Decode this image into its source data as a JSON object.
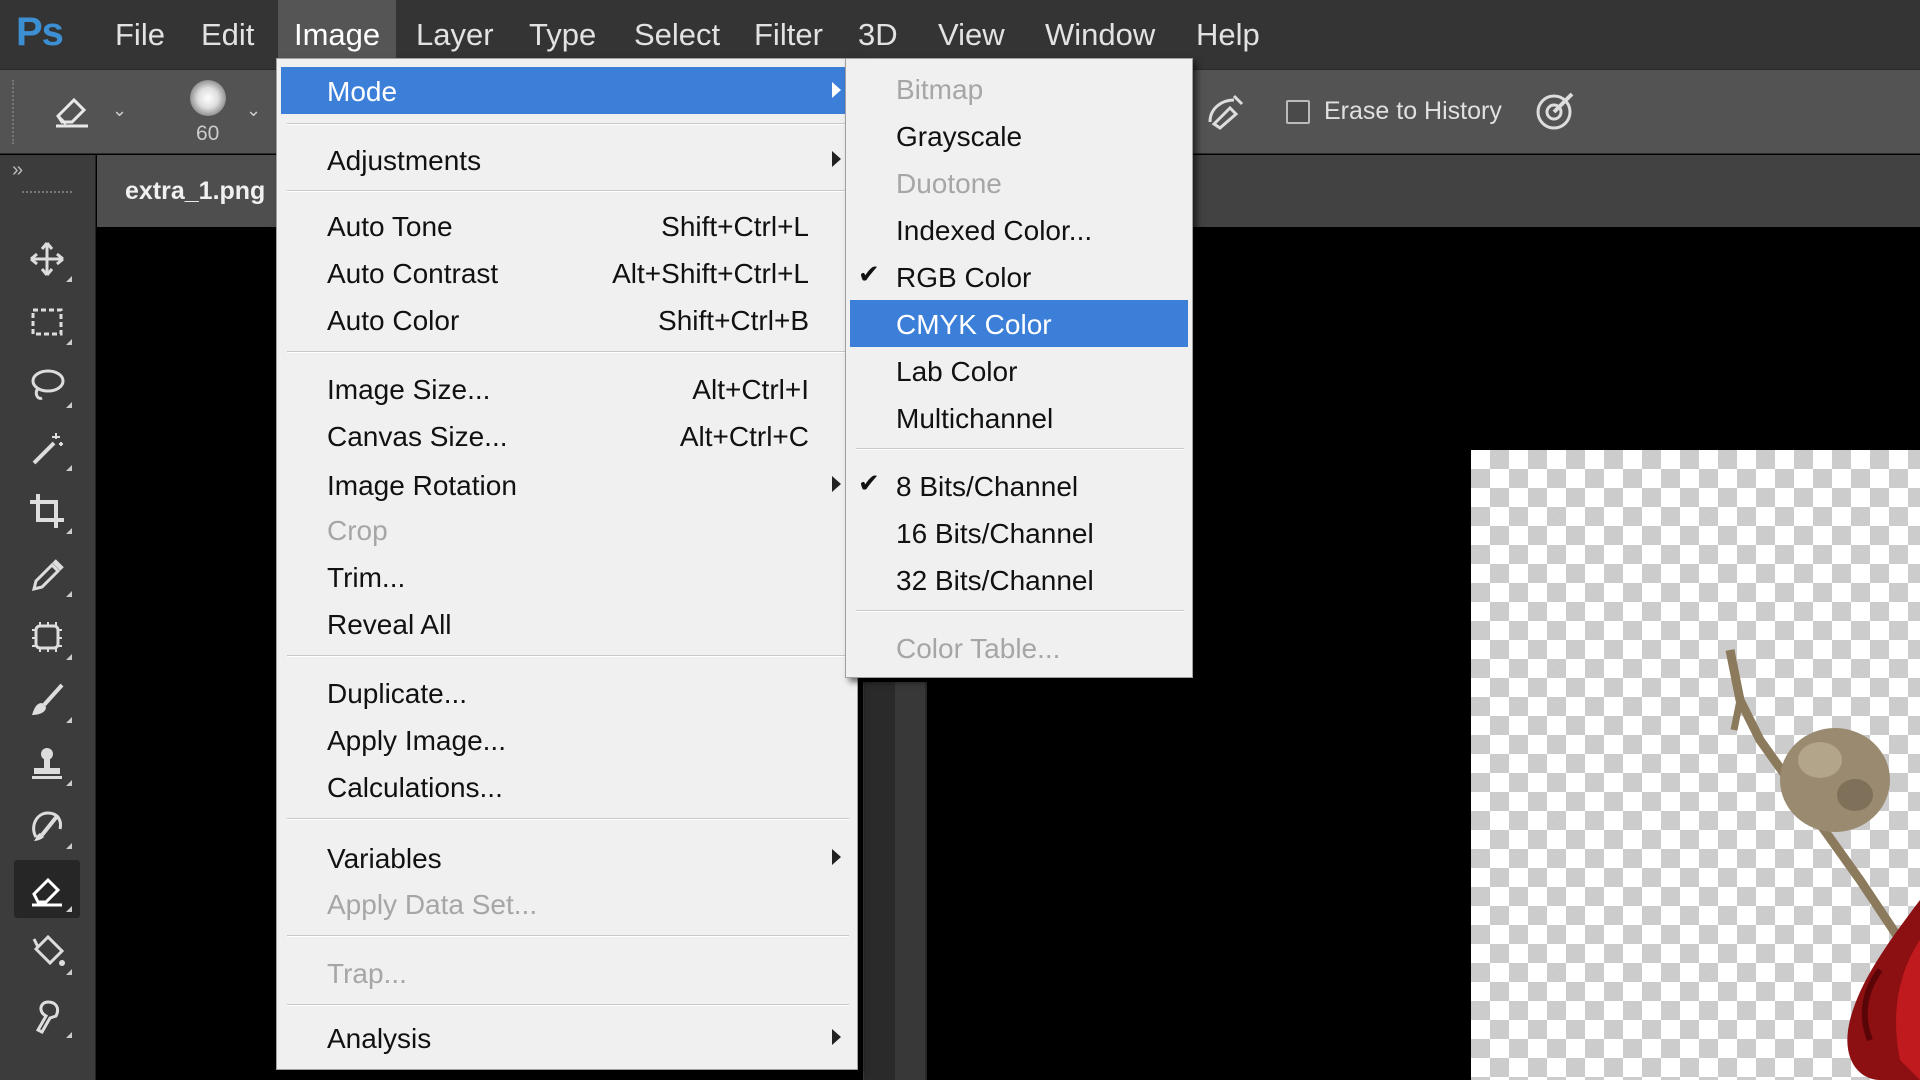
{
  "app": {
    "logo": "Ps"
  },
  "menubar": {
    "items": [
      {
        "label": "File"
      },
      {
        "label": "Edit"
      },
      {
        "label": "Image"
      },
      {
        "label": "Layer"
      },
      {
        "label": "Type"
      },
      {
        "label": "Select"
      },
      {
        "label": "Filter"
      },
      {
        "label": "3D"
      },
      {
        "label": "View"
      },
      {
        "label": "Window"
      },
      {
        "label": "Help"
      }
    ],
    "open_item": "Image"
  },
  "options_bar": {
    "tool_icon": "eraser-icon",
    "brush_size": "60",
    "erase_to_history_label": "Erase to History",
    "erase_to_history_checked": false,
    "airbrush_icon": "airbrush-icon",
    "pressure_icon": "pressure-opacity-icon"
  },
  "toolbox": {
    "collapse": "»",
    "tools": [
      {
        "icon": "move-icon"
      },
      {
        "icon": "rectangular-marquee-icon"
      },
      {
        "icon": "lasso-icon"
      },
      {
        "icon": "magic-wand-icon"
      },
      {
        "icon": "crop-icon"
      },
      {
        "icon": "eyedropper-icon"
      },
      {
        "icon": "patch-tool-icon"
      },
      {
        "icon": "brush-icon"
      },
      {
        "icon": "clone-stamp-icon"
      },
      {
        "icon": "history-brush-icon"
      },
      {
        "icon": "eraser-icon",
        "active": true
      },
      {
        "icon": "paint-bucket-icon"
      },
      {
        "icon": "smudge-icon"
      }
    ]
  },
  "document": {
    "tab_label": "extra_1.png"
  },
  "image_menu": {
    "items": {
      "mode": {
        "label": "Mode",
        "submenu": true,
        "highlighted": true
      },
      "adjustments": {
        "label": "Adjustments",
        "submenu": true
      },
      "auto_tone": {
        "label": "Auto Tone",
        "shortcut": "Shift+Ctrl+L"
      },
      "auto_contrast": {
        "label": "Auto Contrast",
        "shortcut": "Alt+Shift+Ctrl+L"
      },
      "auto_color": {
        "label": "Auto Color",
        "shortcut": "Shift+Ctrl+B"
      },
      "image_size": {
        "label": "Image Size...",
        "shortcut": "Alt+Ctrl+I"
      },
      "canvas_size": {
        "label": "Canvas Size...",
        "shortcut": "Alt+Ctrl+C"
      },
      "image_rotation": {
        "label": "Image Rotation",
        "submenu": true
      },
      "crop": {
        "label": "Crop",
        "disabled": true
      },
      "trim": {
        "label": "Trim..."
      },
      "reveal_all": {
        "label": "Reveal All"
      },
      "duplicate": {
        "label": "Duplicate..."
      },
      "apply_image": {
        "label": "Apply Image..."
      },
      "calculations": {
        "label": "Calculations..."
      },
      "variables": {
        "label": "Variables",
        "submenu": true
      },
      "apply_data_set": {
        "label": "Apply Data Set...",
        "disabled": true
      },
      "trap": {
        "label": "Trap...",
        "disabled": true
      },
      "analysis": {
        "label": "Analysis",
        "submenu": true
      }
    }
  },
  "mode_submenu": {
    "items": {
      "bitmap": {
        "label": "Bitmap",
        "disabled": true
      },
      "grayscale": {
        "label": "Grayscale"
      },
      "duotone": {
        "label": "Duotone",
        "disabled": true
      },
      "indexed_color": {
        "label": "Indexed Color..."
      },
      "rgb_color": {
        "label": "RGB Color",
        "checked": true
      },
      "cmyk_color": {
        "label": "CMYK Color",
        "highlighted": true
      },
      "lab_color": {
        "label": "Lab Color"
      },
      "multichannel": {
        "label": "Multichannel"
      },
      "bits_8": {
        "label": "8 Bits/Channel",
        "checked": true
      },
      "bits_16": {
        "label": "16 Bits/Channel"
      },
      "bits_32": {
        "label": "32 Bits/Channel"
      },
      "color_table": {
        "label": "Color Table...",
        "disabled": true
      }
    },
    "check_glyph": "✔"
  },
  "colors": {
    "menubar": "#343434",
    "menu_bg": "#f0f0f0",
    "menu_highlight": "#3c7fd9",
    "disabled_text": "#a6a6a6",
    "logo": "#3d8fd4"
  }
}
